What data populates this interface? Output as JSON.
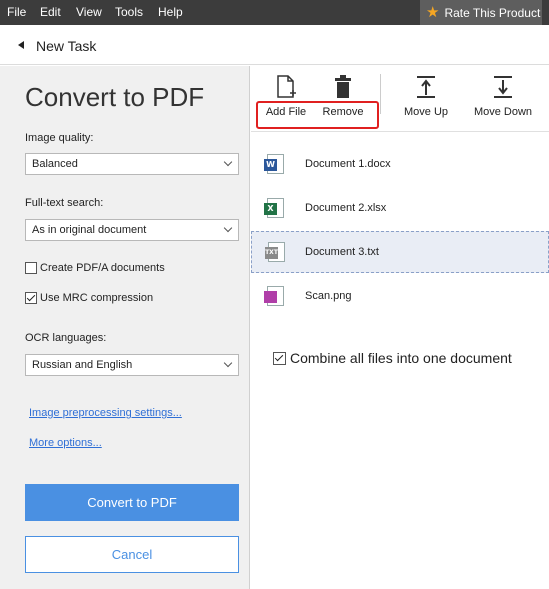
{
  "menu": {
    "items": [
      "File",
      "Edit",
      "View",
      "Tools",
      "Help"
    ],
    "rate_label": "Rate This Product"
  },
  "task": {
    "back_label": "New Task"
  },
  "left": {
    "title": "Convert to PDF",
    "image_quality": {
      "label": "Image quality:",
      "value": "Balanced"
    },
    "full_text_search": {
      "label": "Full-text search:",
      "value": "As in original document"
    },
    "create_pdfa": {
      "label": "Create PDF/A documents",
      "checked": false
    },
    "use_mrc": {
      "label": "Use MRC compression",
      "checked": true
    },
    "ocr_languages": {
      "label": "OCR languages:",
      "value": "Russian and English"
    },
    "links": {
      "preprocessing": "Image preprocessing settings...",
      "more_options": "More options..."
    },
    "convert_label": "Convert to PDF",
    "cancel_label": "Cancel"
  },
  "toolbar": {
    "add_file_label": "Add File",
    "remove_label": "Remove",
    "move_up_label": "Move Up",
    "move_down_label": "Move Down"
  },
  "files": [
    {
      "name": "Document 1.docx",
      "icon": "word-file-icon",
      "tag": "W",
      "color": "#2b579a"
    },
    {
      "name": "Document 2.xlsx",
      "icon": "excel-file-icon",
      "tag": "X",
      "color": "#217346"
    },
    {
      "name": "Document 3.txt",
      "icon": "text-file-icon",
      "tag": "TXT",
      "color": "#8a8a8a"
    },
    {
      "name": "Scan.png",
      "icon": "image-file-icon",
      "tag": "",
      "color": "#b03ea8"
    }
  ],
  "combine": {
    "label": "Combine all files into one document",
    "checked": true
  },
  "colors": {
    "accent": "#4a90e2",
    "highlight": "#e02020",
    "menubar": "#3c3c3c"
  }
}
